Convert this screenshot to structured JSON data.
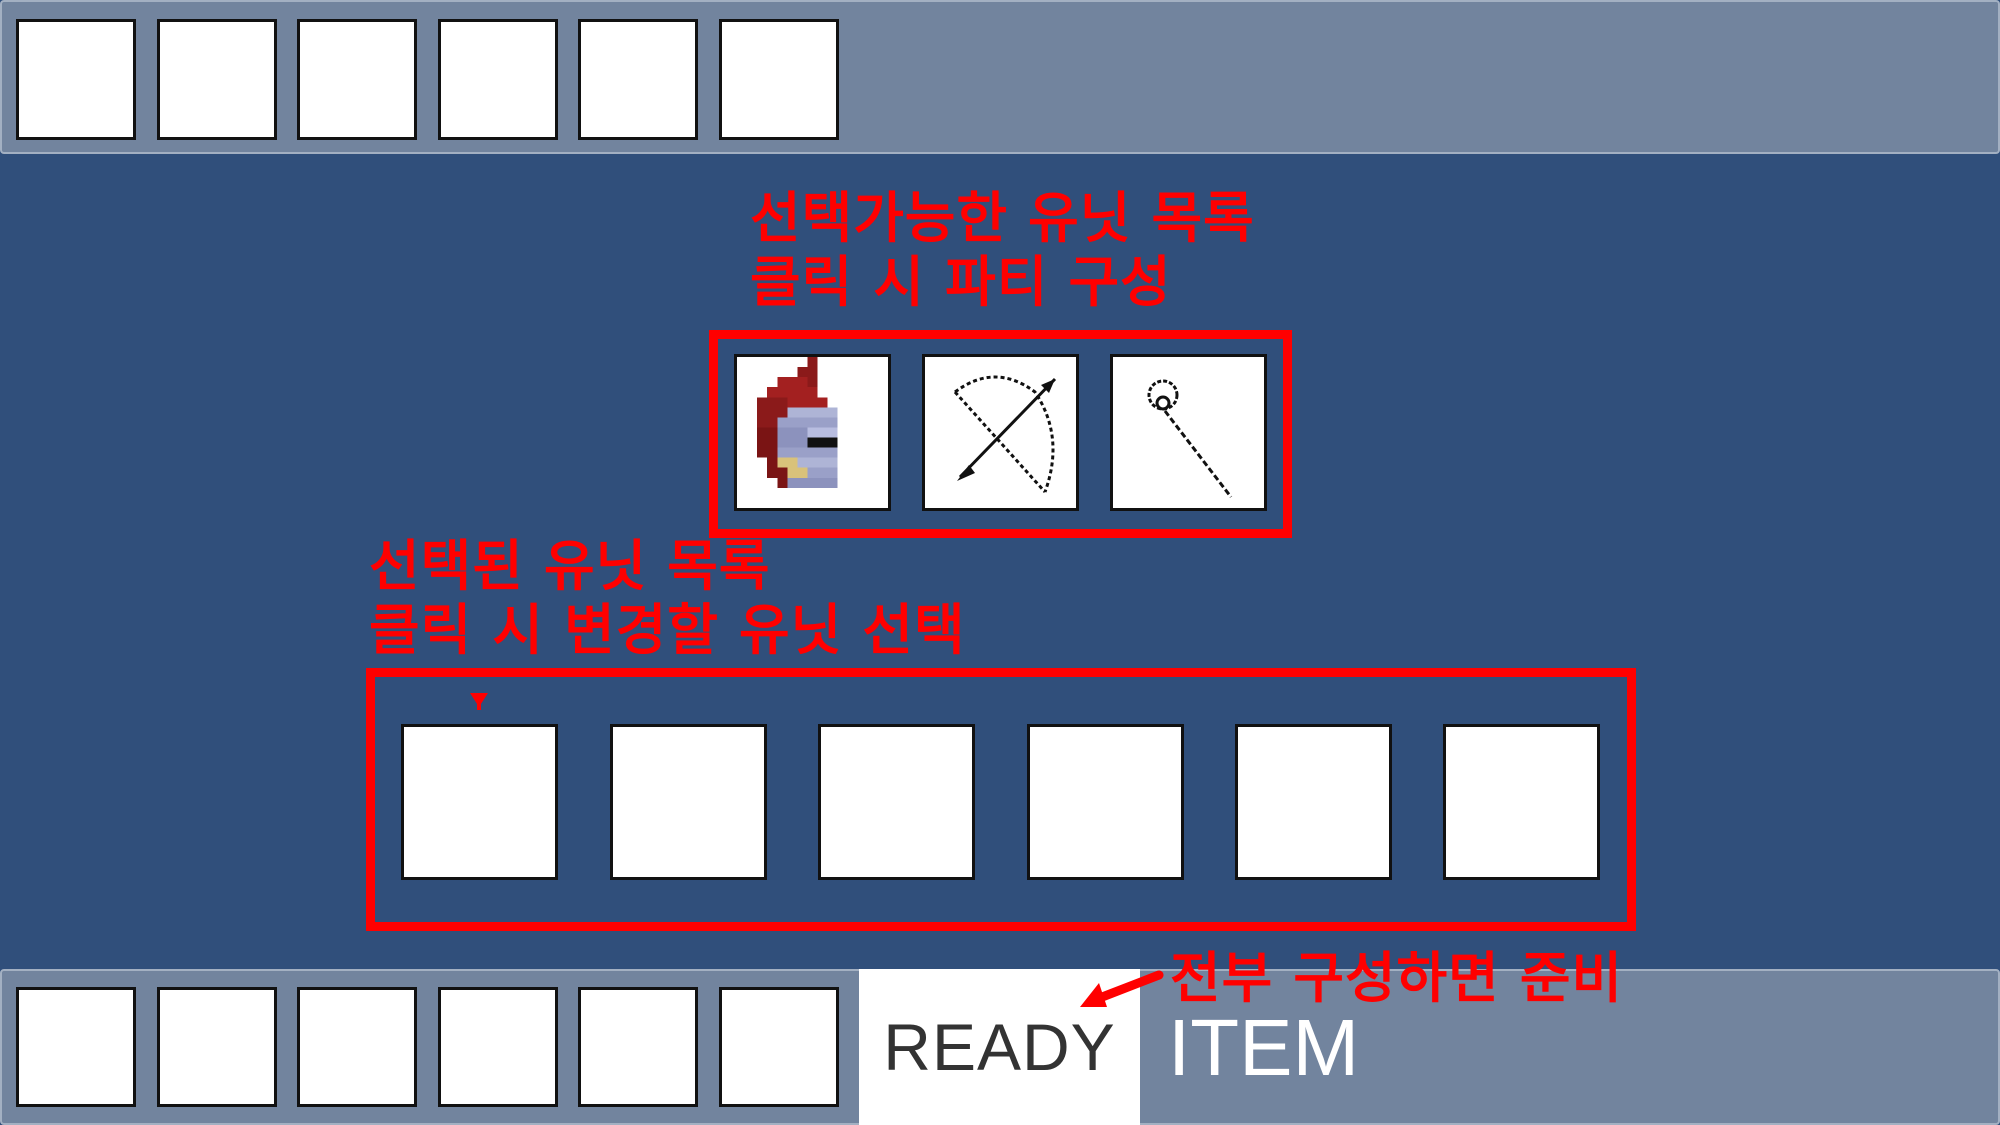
{
  "top_bar": {
    "slot_count": 6
  },
  "unit_select": {
    "annotation_line1": "선택가능한 유닛 목록",
    "annotation_line2": "클릭 시 파티 구성",
    "units": [
      {
        "icon": "knight-helmet-icon"
      },
      {
        "icon": "bow-arrow-icon"
      },
      {
        "icon": "magic-staff-icon"
      }
    ]
  },
  "party": {
    "annotation_line1": "선택된 유닛 목록",
    "annotation_line2": "클릭 시 변경할 유닛 선택",
    "slot_count": 6,
    "selected_slot_index": 0
  },
  "bottom_bar": {
    "slot_count": 6,
    "ready_label": "READY",
    "item_label": "ITEM",
    "ready_annotation": "전부 구성하면 준비"
  },
  "colors": {
    "background": "#304f7b",
    "bar": "#72849e",
    "annotation_red": "#ff0000"
  }
}
